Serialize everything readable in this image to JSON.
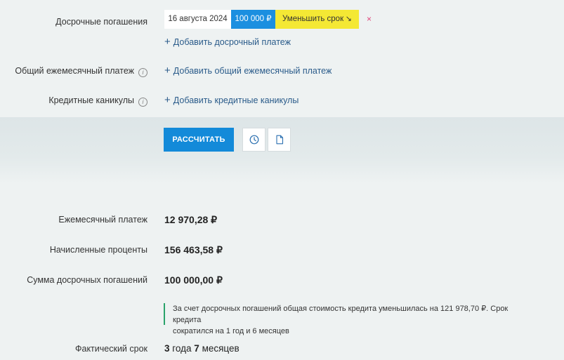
{
  "early_repayment": {
    "label": "Досрочные погашения",
    "date": "16 августа 2024",
    "amount": "100 000 ₽",
    "mode": "Уменьшить срок",
    "mode_arrow": "↘",
    "remove": "×",
    "add_link": "Добавить досрочный платеж"
  },
  "common_monthly": {
    "label": "Общий ежемесячный платеж",
    "add_link": "Добавить общий ежемесячный платеж"
  },
  "holidays": {
    "label": "Кредитные каникулы",
    "add_link": "Добавить кредитные каникулы"
  },
  "info_glyph": "i",
  "plus_glyph": "+",
  "actions": {
    "calculate": "РАССЧИТАТЬ",
    "history_icon": "clock-icon",
    "document_icon": "document-icon"
  },
  "results": {
    "monthly_payment": {
      "label": "Ежемесячный платеж",
      "value": "12 970,28 ₽"
    },
    "accrued_interest": {
      "label": "Начисленные проценты",
      "value": "156 463,58 ₽"
    },
    "early_total": {
      "label": "Сумма досрочных погашений",
      "value": "100 000,00 ₽"
    },
    "note_line1": "За счет досрочных погашений общая стоимость кредита уменьшилась на 121 978,70 ₽. Срок кредита",
    "note_line2": "сократился на 1 год и 6 месяцев",
    "term": {
      "label": "Фактический срок",
      "years": "3",
      "years_word": "года",
      "months": "7",
      "months_word": "месяцев"
    }
  },
  "colors": {
    "accent": "#138ad9",
    "amount_chip": "#1b8fe0",
    "mode_chip": "#f4e834",
    "link": "#2a5b8a",
    "note_border": "#2aa36b",
    "remove": "#e0457a"
  }
}
